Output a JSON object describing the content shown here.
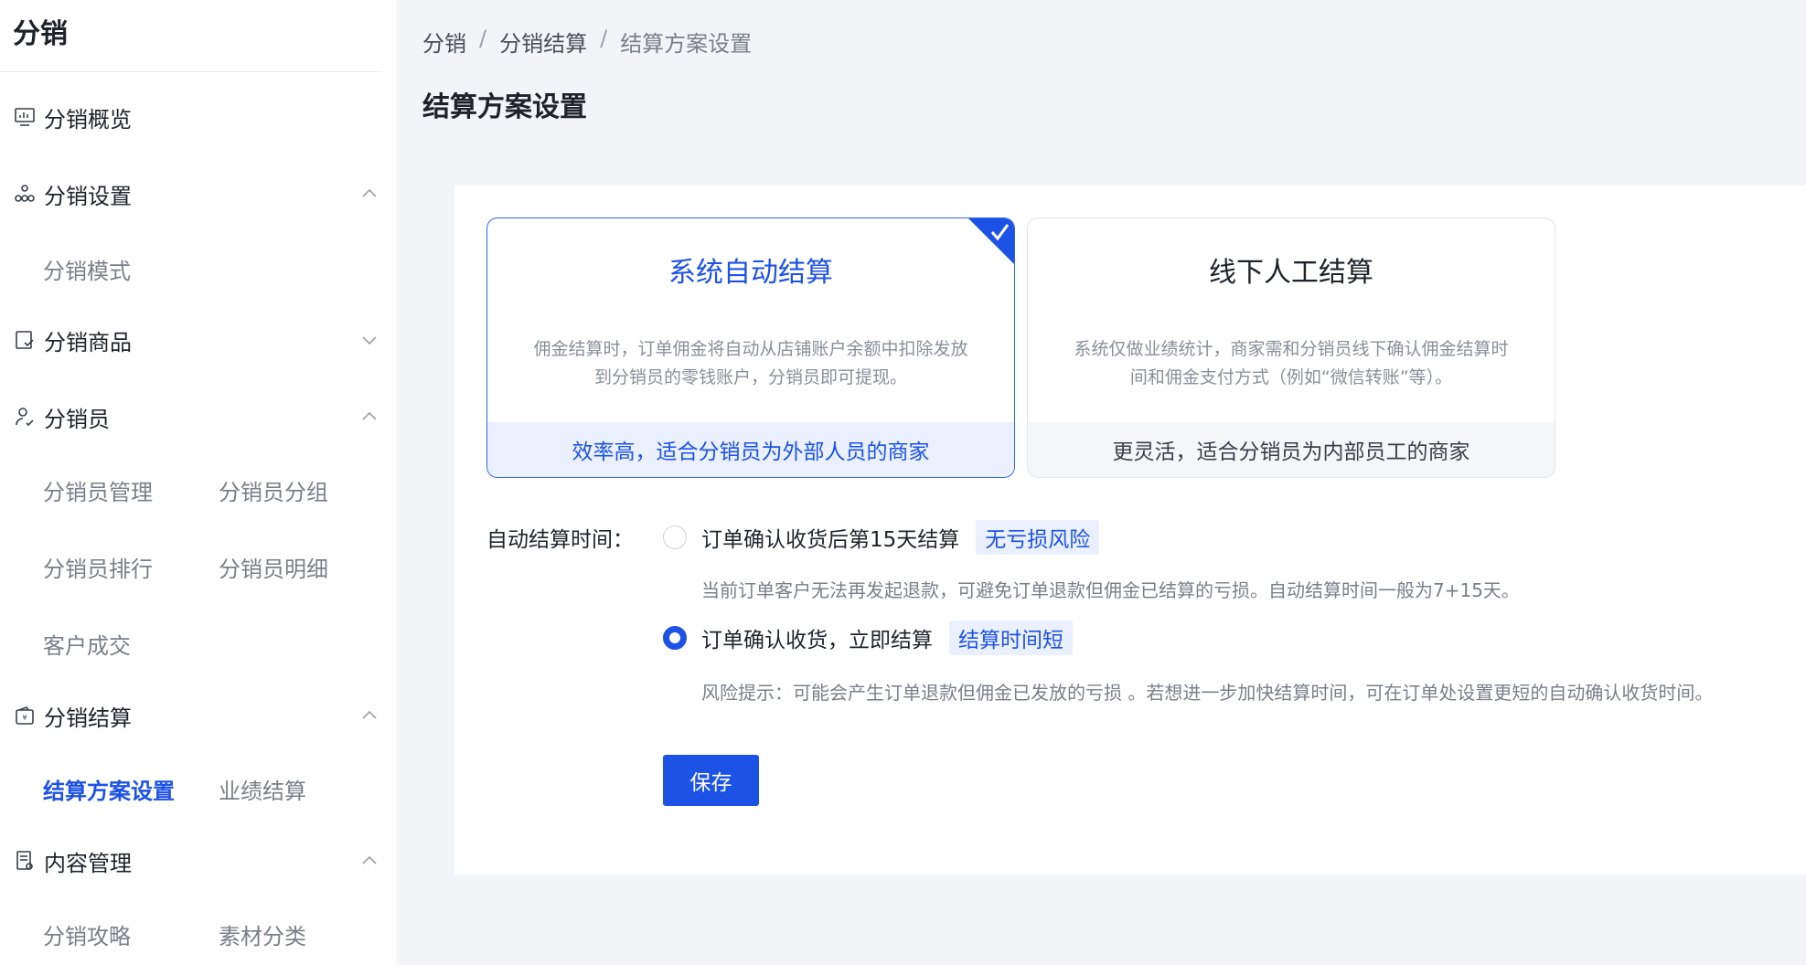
{
  "sidebar": {
    "title": "分销",
    "groups": [
      {
        "label": "分销概览",
        "icon": "dashboard-icon"
      },
      {
        "label": "分销设置",
        "icon": "network-icon"
      },
      {
        "label": "分销商品",
        "icon": "goods-icon"
      },
      {
        "label": "分销员",
        "icon": "user-icon"
      },
      {
        "label": "分销结算",
        "icon": "wallet-icon"
      },
      {
        "label": "内容管理",
        "icon": "document-icon"
      }
    ],
    "subs": {
      "mode": "分销模式",
      "member_manage": "分销员管理",
      "member_group": "分销员分组",
      "member_rank": "分销员排行",
      "member_detail": "分销员明细",
      "customer_deal": "客户成交",
      "settle_plan": "结算方案设置",
      "perf_settle": "业绩结算",
      "strategy": "分销攻略",
      "material_cat": "素材分类"
    }
  },
  "breadcrumb": [
    "分销",
    "分销结算",
    "结算方案设置"
  ],
  "page_title": "结算方案设置",
  "cards": [
    {
      "title": "系统自动结算",
      "desc": "佣金结算时，订单佣金将自动从店铺账户余额中扣除发放到分销员的零钱账户，分销员即可提现。",
      "foot": "效率高，适合分销员为外部人员的商家",
      "selected": true
    },
    {
      "title": "线下人工结算",
      "desc": "系统仅做业绩统计，商家需和分销员线下确认佣金结算时间和佣金支付方式（例如“微信转账”等）。",
      "foot": "更灵活，适合分销员为内部员工的商家",
      "selected": false
    }
  ],
  "settle_time": {
    "label": "自动结算时间：",
    "options": [
      {
        "label": "订单确认收货后第15天结算",
        "tag": "无亏损风险",
        "desc": "当前订单客户无法再发起退款，可避免订单退款但佣金已结算的亏损。自动结算时间一般为7+15天。",
        "checked": false
      },
      {
        "label": "订单确认收货，立即结算",
        "tag": "结算时间短",
        "desc": "风险提示：可能会产生订单退款但佣金已发放的亏损 。若想进一步加快结算时间，可在订单处设置更短的自动确认收货时间。",
        "checked": true
      }
    ]
  },
  "save_label": "保存",
  "colors": {
    "accent": "#1d52e6",
    "accent_light": "#eaf0fd"
  }
}
